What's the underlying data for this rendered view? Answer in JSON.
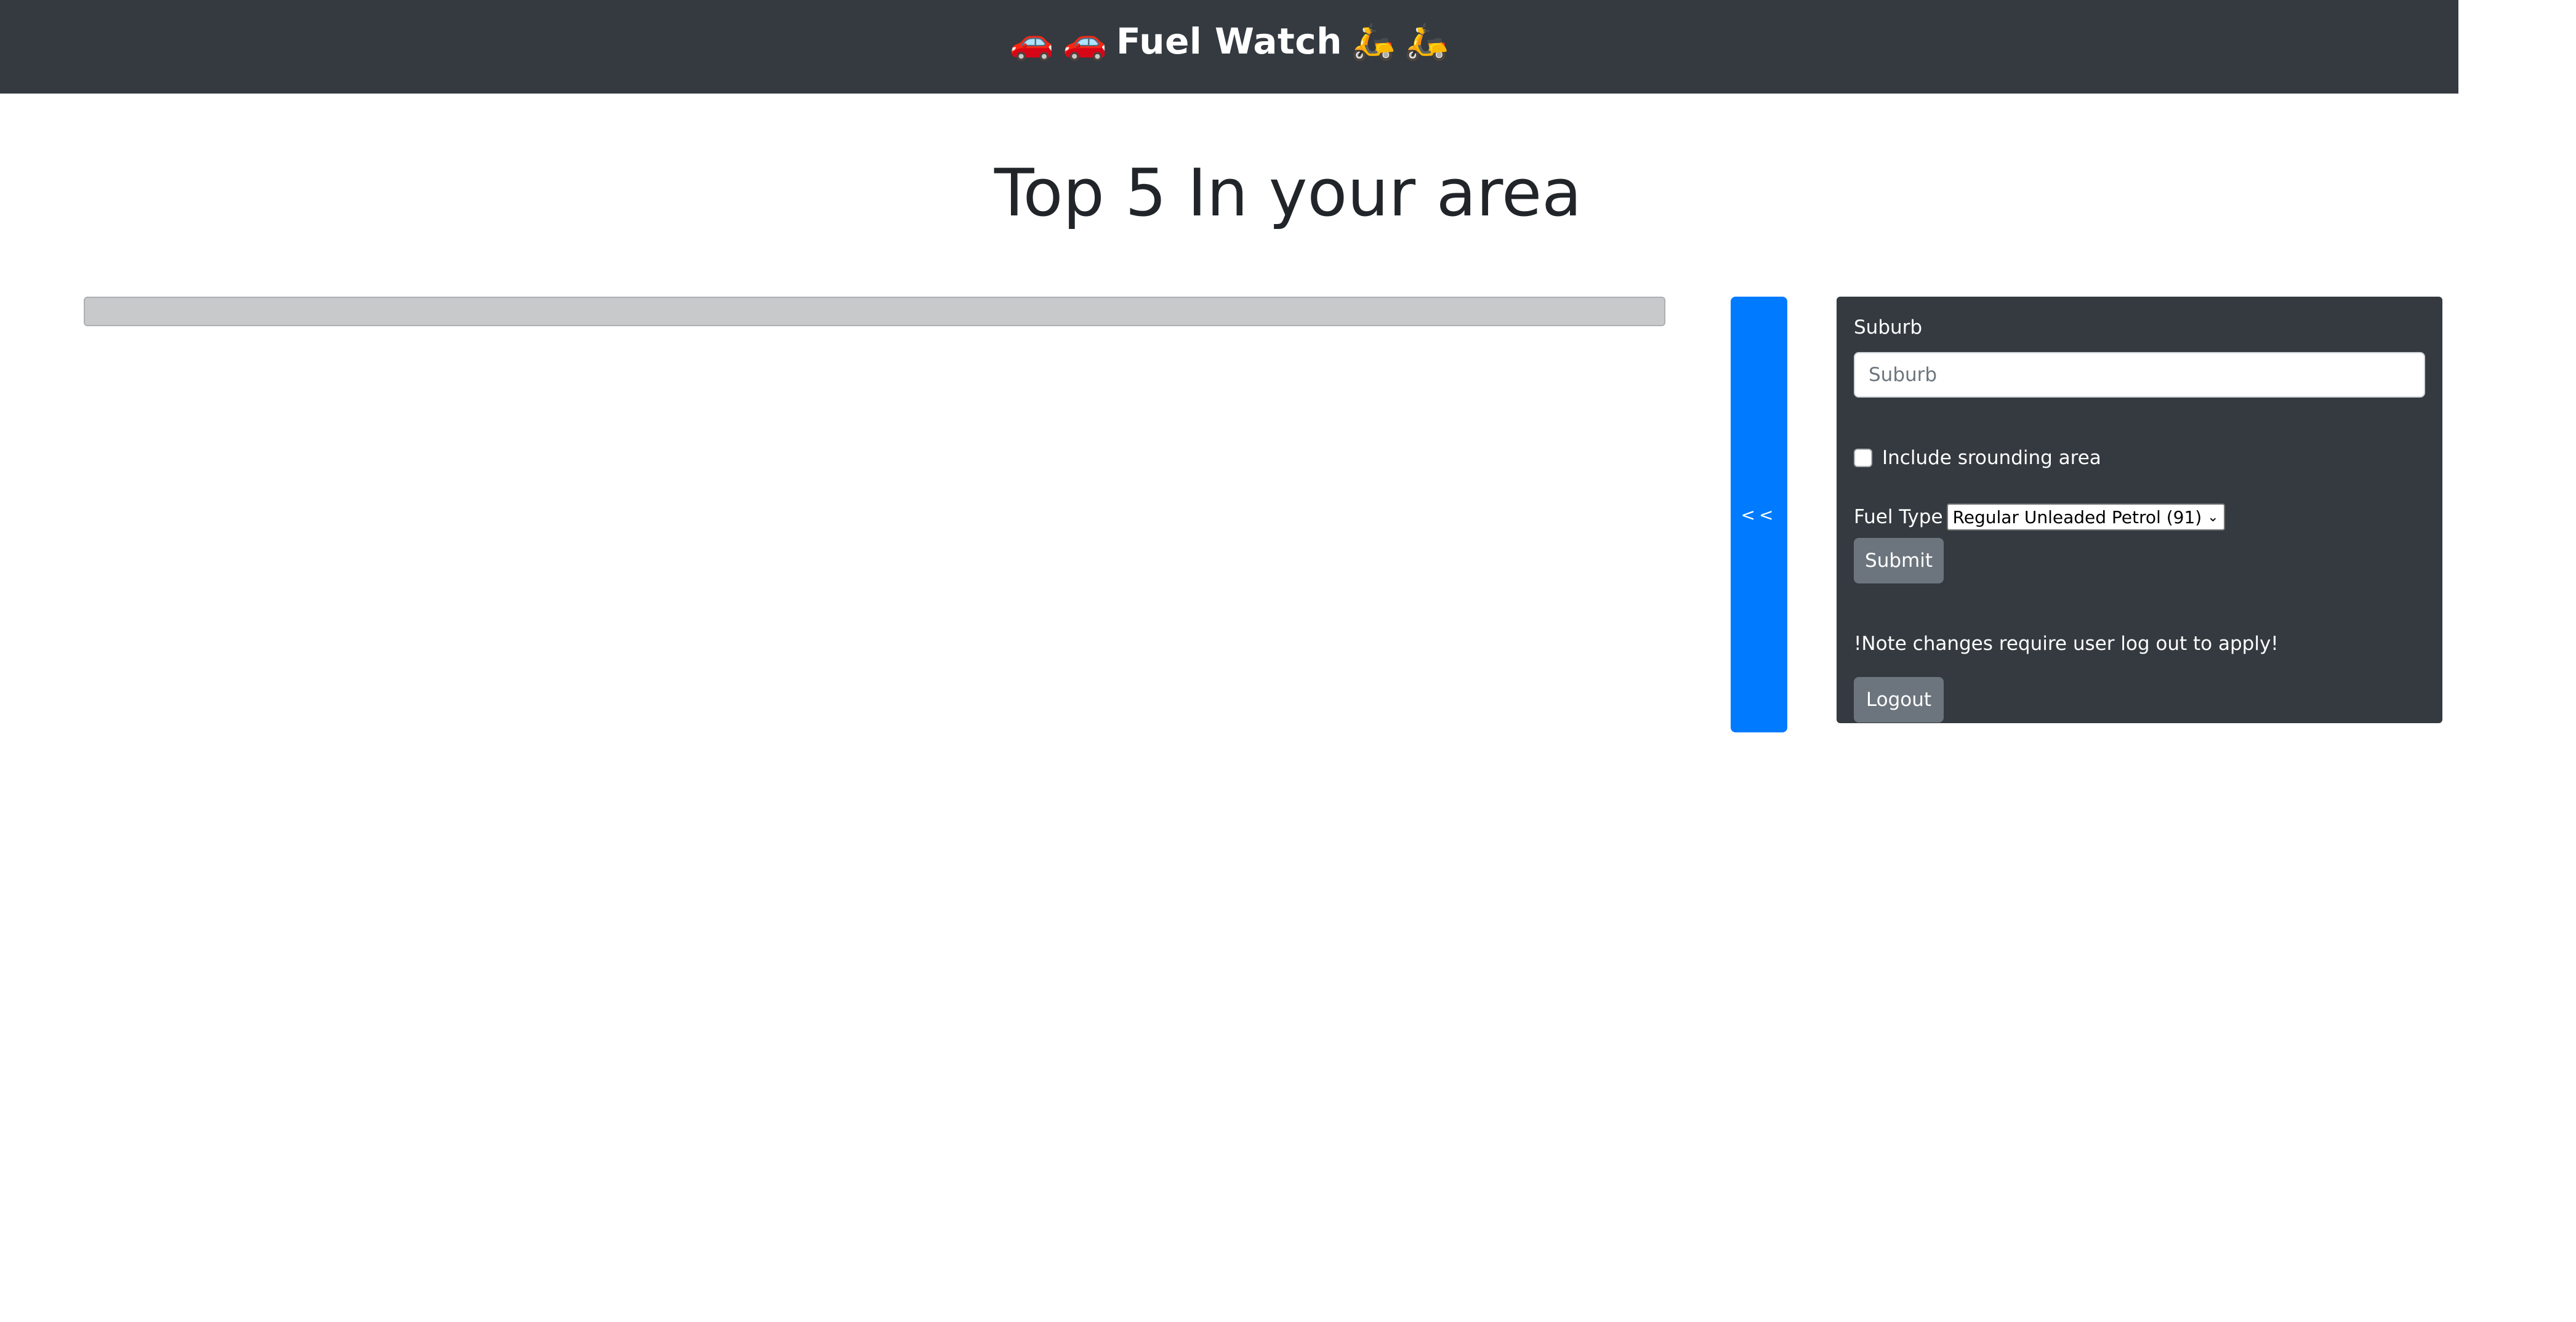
{
  "header": {
    "emoji_left": [
      "🚗",
      "🚗"
    ],
    "title": "Fuel Watch",
    "emoji_right": [
      "🛵",
      "🛵"
    ]
  },
  "main": {
    "heading": "Top 5 In your area",
    "toggle_label": "<<"
  },
  "panel": {
    "suburb_label": "Suburb",
    "suburb_placeholder": "Suburb",
    "suburb_value": "",
    "include_label": "Include srounding area",
    "include_checked": false,
    "fuel_label": "Fuel Type",
    "fuel_selected": "Regular Unleaded Petrol (91)",
    "submit_label": "Submit",
    "note": "!Note changes require user log out to apply!",
    "logout_label": "Logout"
  },
  "colors": {
    "navbar": "#343a40",
    "primary": "#007bff",
    "secondary": "#6c757d",
    "loading_bar": "#c8c9cb"
  }
}
